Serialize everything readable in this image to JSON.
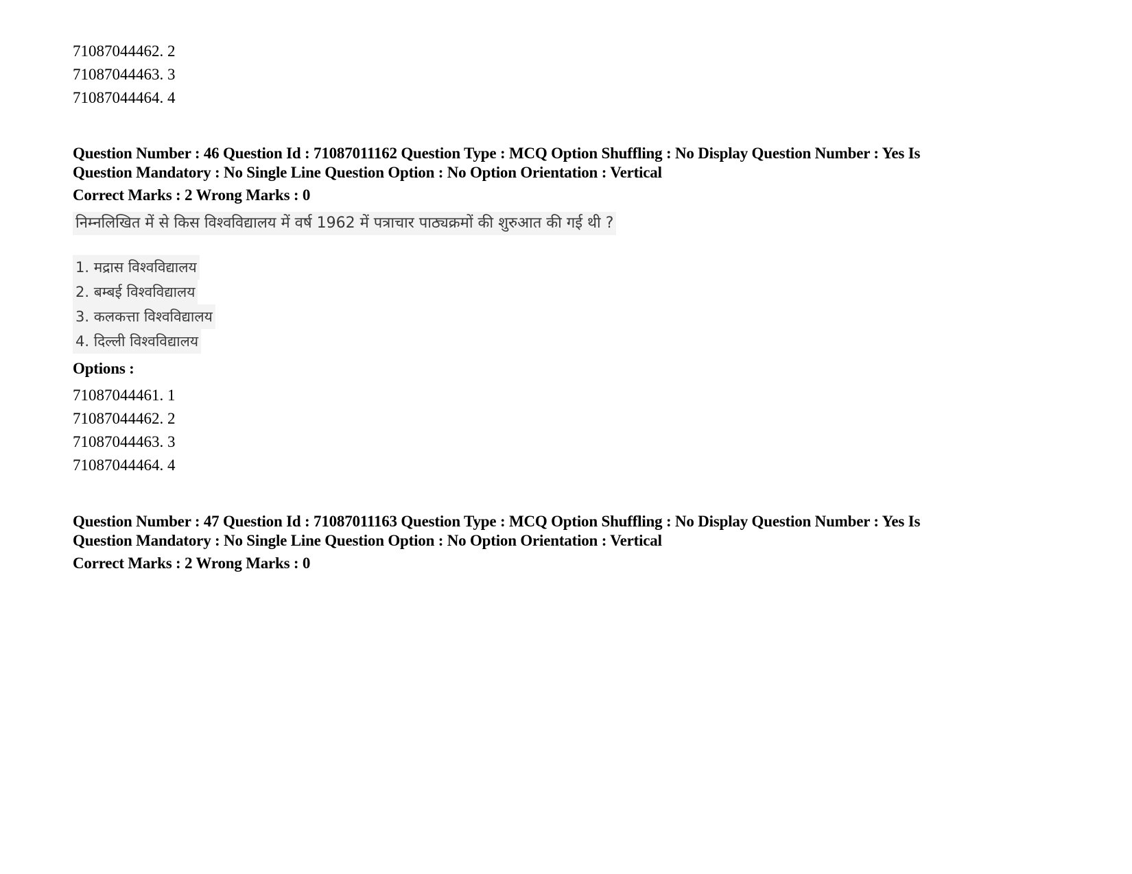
{
  "previous_question_options": [
    "71087044462. 2",
    "71087044463. 3",
    "71087044464. 4"
  ],
  "questions": [
    {
      "meta_line1": "Question Number : 46 Question Id : 71087011162 Question Type : MCQ Option Shuffling : No Display Question Number : Yes Is",
      "meta_line2": "Question Mandatory : No Single Line Question Option : No Option Orientation : Vertical",
      "marks": "Correct Marks : 2 Wrong Marks : 0",
      "question_text": "निम्नलिखित में से किस विश्वविद्यालय में वर्ष 1962 में पत्राचार पाठ्यक्रमों की शुरुआत की गई थी ?",
      "choices": [
        "1. मद्रास विश्वविद्यालय",
        "2. बम्बई विश्वविद्यालय",
        "3. कलकत्ता विश्वविद्यालय",
        "4. दिल्ली विश्वविद्यालय"
      ],
      "options_label": "Options :",
      "options": [
        "71087044461. 1",
        "71087044462. 2",
        "71087044463. 3",
        "71087044464. 4"
      ]
    },
    {
      "meta_line1": "Question Number : 47 Question Id : 71087011163 Question Type : MCQ Option Shuffling : No Display Question Number : Yes Is",
      "meta_line2": "Question Mandatory : No Single Line Question Option : No Option Orientation : Vertical",
      "marks": "Correct Marks : 2 Wrong Marks : 0"
    }
  ]
}
